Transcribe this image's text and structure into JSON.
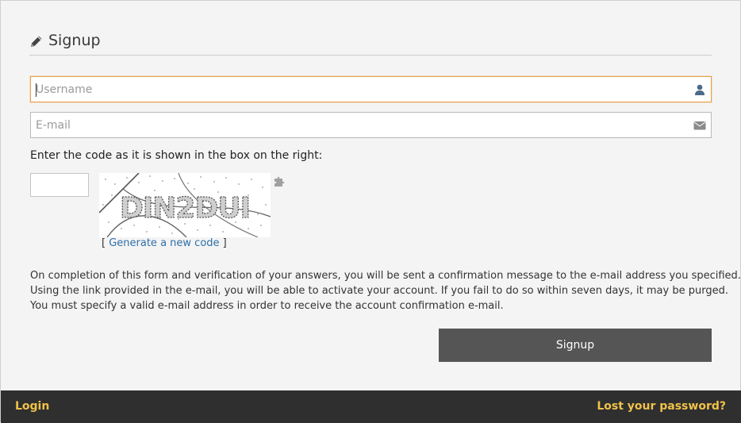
{
  "header": {
    "title": "Signup",
    "icon": "pencil-icon"
  },
  "form": {
    "username": {
      "placeholder": "Username",
      "value": "",
      "icon": "user-icon"
    },
    "email": {
      "placeholder": "E-mail",
      "value": "",
      "icon": "envelope-icon"
    },
    "code_label": "Enter the code as it is shown in the box on the right:",
    "code_value": "",
    "captcha_text": "DIN2DUI",
    "generate_prefix": "[",
    "generate_link": "Generate a new code",
    "generate_suffix": "]"
  },
  "info": {
    "line1": "On completion of this form and verification of your answers, you will be sent a confirmation message to the e-mail address you specified.",
    "line2": "Using the link provided in the e-mail, you will be able to activate your account. If you fail to do so within seven days, it may be purged.",
    "line3": "You must specify a valid e-mail address in order to receive the account confirmation e-mail."
  },
  "buttons": {
    "signup": "Signup"
  },
  "footer": {
    "login": "Login",
    "lost_password": "Lost your password?"
  },
  "colors": {
    "focus_border": "#e8a04a",
    "button_bg": "#555555",
    "footer_bg": "#2f2f2f",
    "footer_link": "#f0c24a",
    "link": "#2f6fa7"
  }
}
